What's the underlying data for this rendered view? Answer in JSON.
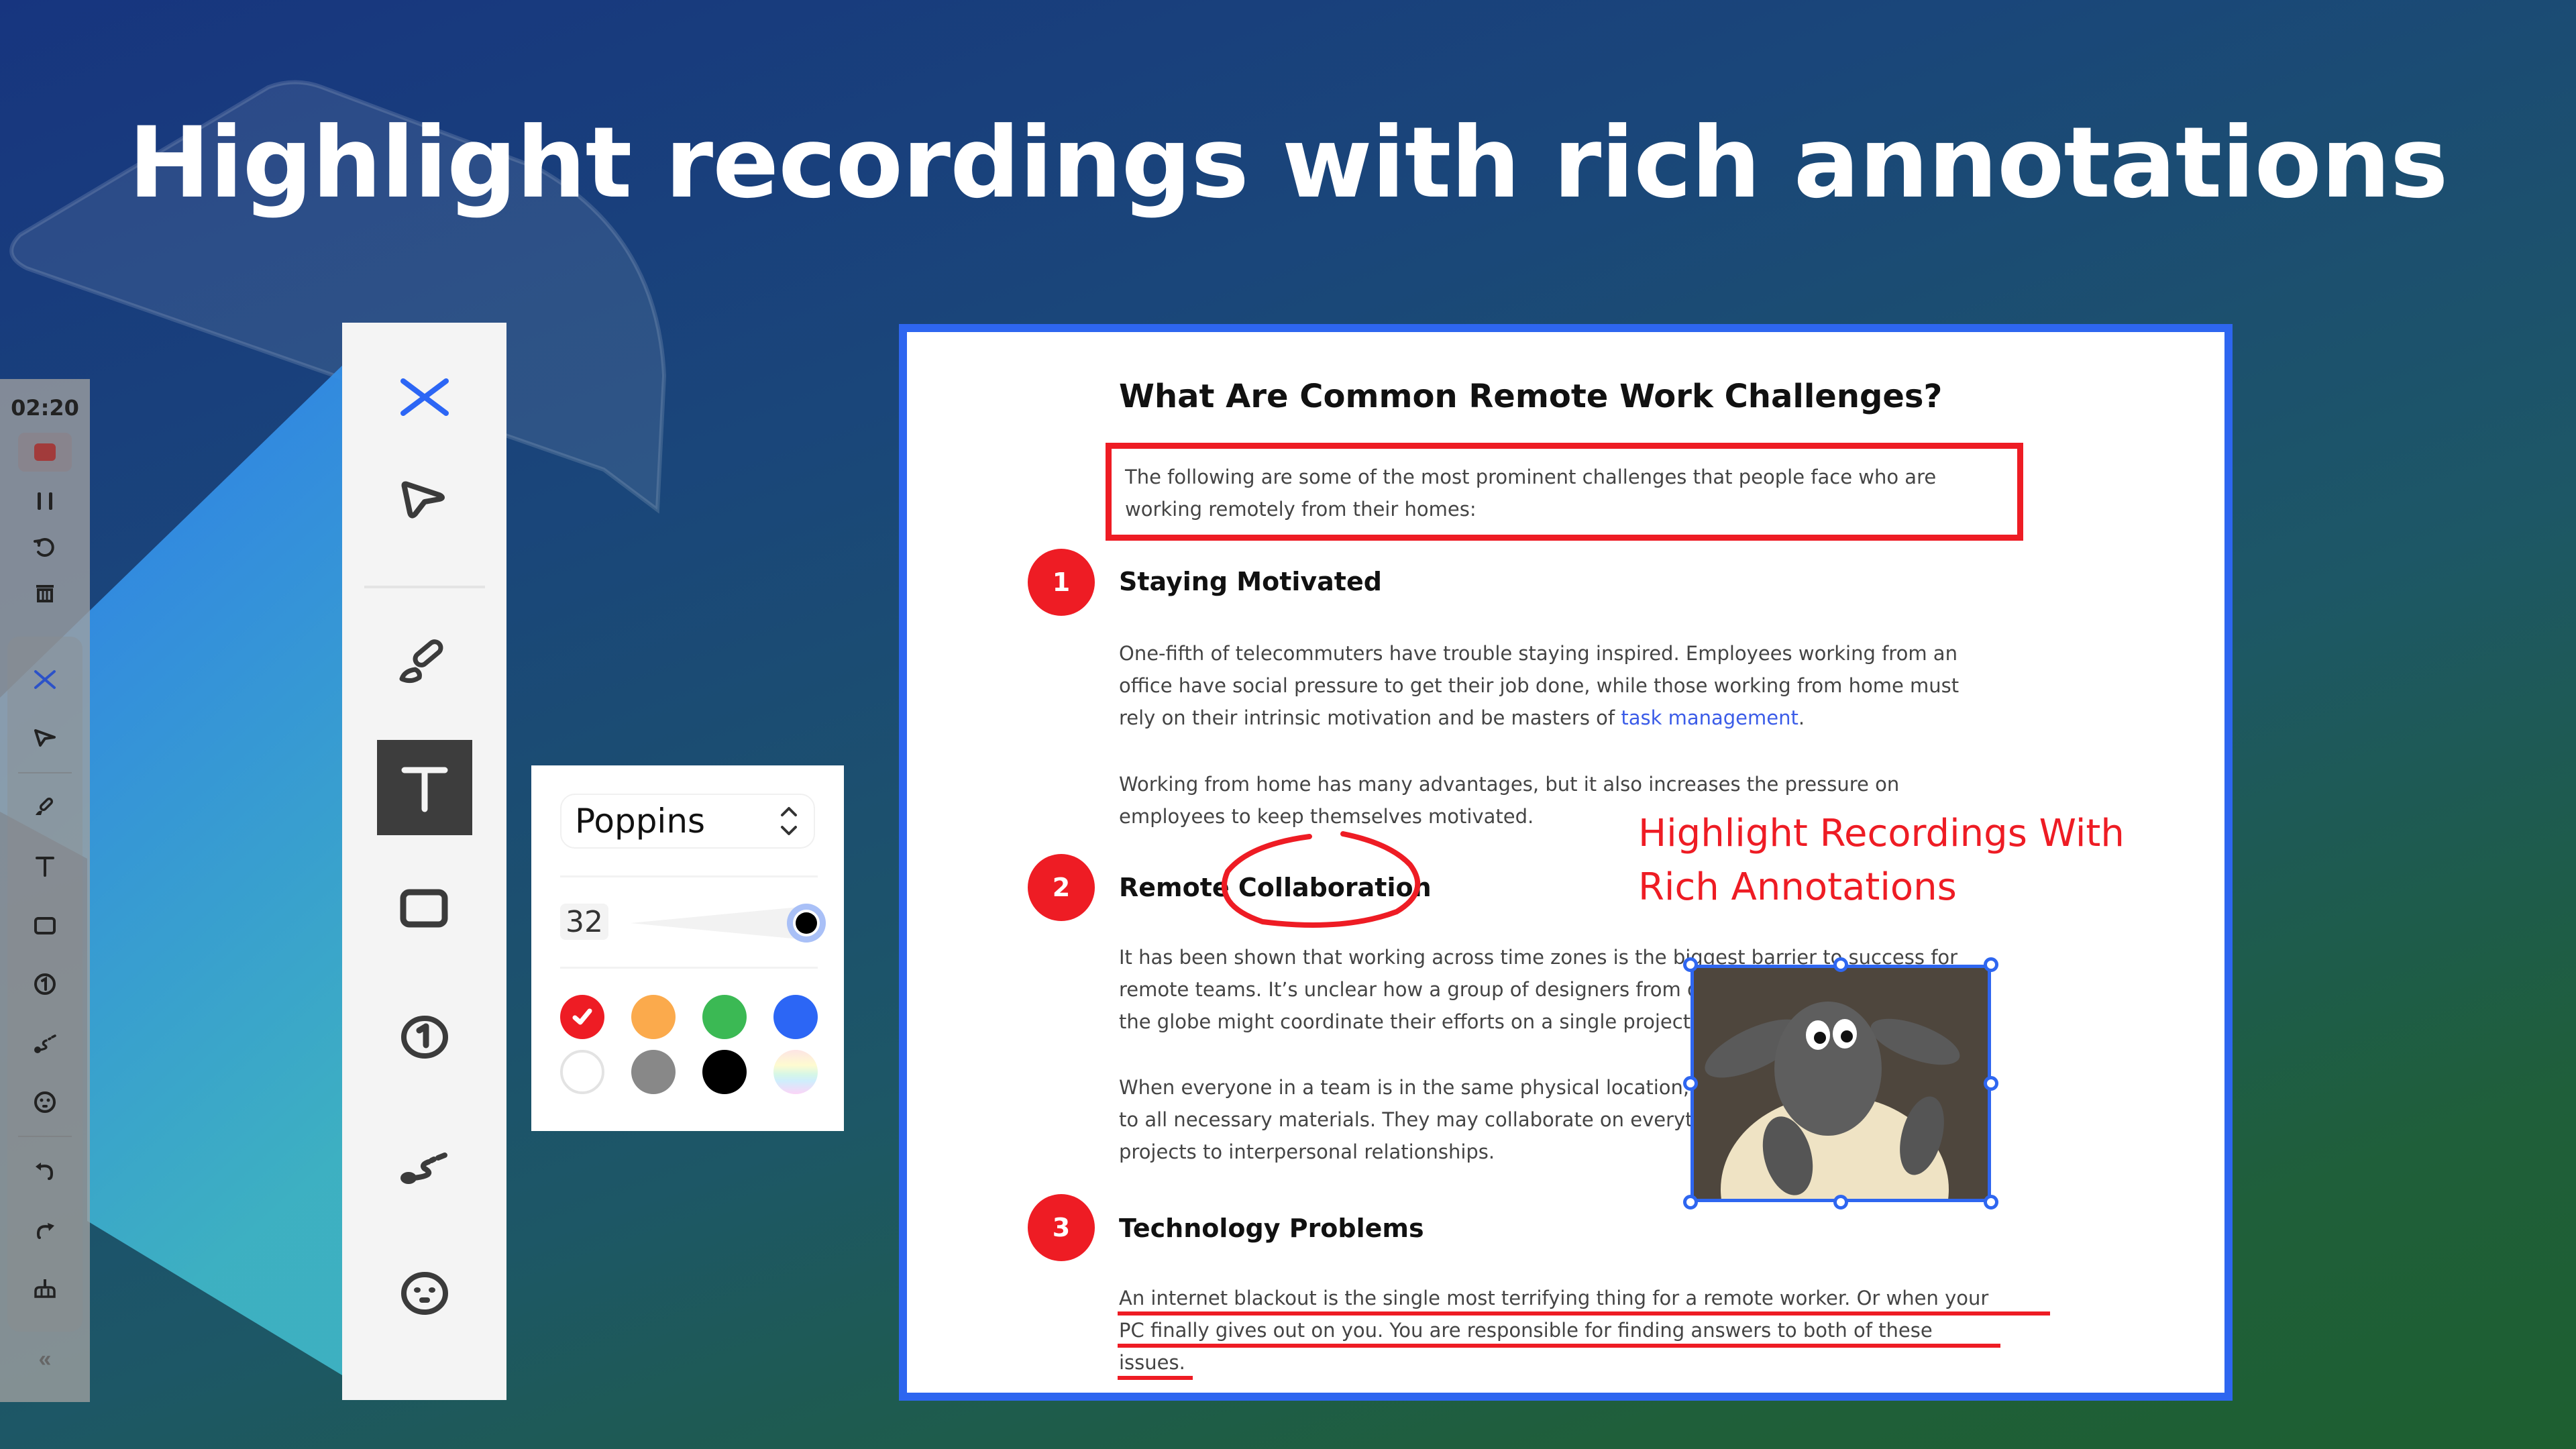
{
  "headline": "Highlight recordings with rich annotations",
  "mini_toolbar": {
    "timer": "02:20",
    "icons": [
      "stop-icon",
      "pause-icon",
      "restart-icon",
      "trash-icon",
      "close-icon",
      "cursor-icon",
      "brush-icon",
      "text-icon",
      "rectangle-icon",
      "number-icon",
      "spotlight-icon",
      "emoji-icon",
      "undo-icon",
      "redo-icon",
      "clear-icon"
    ],
    "collapse_label": "«"
  },
  "toolbar": {
    "tools": [
      {
        "name": "close",
        "icon": "close-icon",
        "active": false
      },
      {
        "name": "select",
        "icon": "cursor-icon",
        "active": false
      },
      {
        "name": "brush",
        "icon": "brush-icon",
        "active": false
      },
      {
        "name": "text",
        "icon": "text-icon",
        "active": true
      },
      {
        "name": "rectangle",
        "icon": "rectangle-icon",
        "active": false
      },
      {
        "name": "number",
        "icon": "number-icon",
        "active": false
      },
      {
        "name": "spotlight",
        "icon": "spotlight-icon",
        "active": false
      },
      {
        "name": "emoji",
        "icon": "emoji-icon",
        "active": false
      }
    ]
  },
  "text_panel": {
    "font": "Poppins",
    "size": "32",
    "size_fraction": 1.0,
    "selected_color": "#ee1c24",
    "colors": [
      "#ee1c24",
      "#fbaa4c",
      "#3bb954",
      "#2c66f5",
      "#ffffff",
      "#888888",
      "#000000",
      "rainbow"
    ]
  },
  "document": {
    "title": "What Are Common Remote Work Challenges?",
    "intro_line1": "The following are some of the most prominent challenges that people face who are",
    "intro_line2": "working remotely from their homes:",
    "sections": [
      {
        "number": "1",
        "heading": "Staying Motivated",
        "p1_line1": "One-fifth of telecommuters have trouble staying inspired. Employees working from an",
        "p1_line2": "office have social pressure to get their job done, while those working from home must",
        "p1_line3_pre": "rely on their intrinsic motivation and be masters of ",
        "p1_link": "task management",
        "p1_line3_post": ".",
        "p2_line1": "Working from home has many advantages, but it also increases the pressure on",
        "p2_line2": "employees to keep themselves motivated."
      },
      {
        "number": "2",
        "heading_a": "Remote",
        "heading_b": "Collaboration",
        "p1_line1": "It has been shown that working across time zones is the biggest barrier to success for",
        "p1_line2": "remote teams. It’s unclear how a group of designers from different locations on or",
        "p1_line3": "the globe might coordinate their efforts on a single project.",
        "p2_line1": "When everyone in a team is in the same physical location, they have easy access",
        "p2_line2": "to all necessary materials. They may collaborate on everything from",
        "p2_line3": "projects to interpersonal relationships."
      },
      {
        "number": "3",
        "heading": "Technology Problems",
        "p1_line1": "An internet blackout is the single most terrifying thing for a remote worker. Or when your",
        "p1_line2": "PC finally gives out on you. You are responsible for finding answers to both of these",
        "p1_line3": "issues."
      }
    ],
    "annotation_text_line1": "Highlight Recordings With",
    "annotation_text_line2": "Rich Annotations",
    "sticker": "sheep-sticker-image"
  }
}
